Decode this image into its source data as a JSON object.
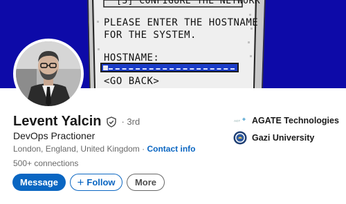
{
  "banner": {
    "line_top": "[3] CONFIGURE THE NETWORK",
    "line_1": "PLEASE ENTER THE HOSTNAME",
    "line_2": "FOR THE SYSTEM.",
    "hostname_label": "HOSTNAME:",
    "go_back": "<GO BACK>",
    "color": "#0d0aa8"
  },
  "profile": {
    "name": "Levent Yalcin",
    "degree": "· 3rd",
    "headline": "DevOps Practioner",
    "location": "London, England, United Kingdom ·",
    "contact_info": "Contact info",
    "connections": "500+ connections"
  },
  "actions": {
    "message": "Message",
    "follow": "Follow",
    "follow_icon": "+",
    "more": "More"
  },
  "orgs": [
    {
      "name": "AGATE Technologies",
      "logo": "agate-logo"
    },
    {
      "name": "Gazi University",
      "logo": "gazi-university-seal"
    }
  ],
  "colors": {
    "accent": "#0a66c2",
    "text_primary": "rgba(0,0,0,0.9)",
    "text_secondary": "rgba(0,0,0,0.6)"
  }
}
